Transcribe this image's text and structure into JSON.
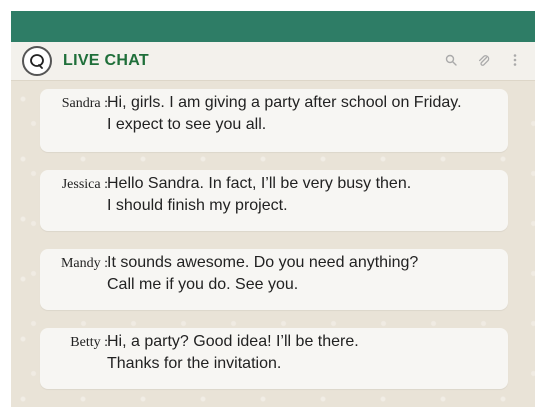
{
  "header": {
    "title": "LIVE CHAT"
  },
  "messages": [
    {
      "speaker": "Sandra :",
      "lines": [
        "Hi, girls. I am giving a party after school on Friday.",
        "I expect to see you all."
      ]
    },
    {
      "speaker": "Jessica :",
      "lines": [
        "Hello Sandra. In fact, I’ll be very busy then.",
        "I should finish my project."
      ]
    },
    {
      "speaker": "Mandy :",
      "lines": [
        "It sounds awesome. Do you need anything?",
        "Call me if you do. See you."
      ]
    },
    {
      "speaker": "Betty :",
      "lines": [
        "Hi, a party? Good idea! I’ll be there.",
        "Thanks for the invitation."
      ]
    }
  ],
  "icons": [
    "chat-logo-icon",
    "search-icon",
    "attach-icon",
    "more-vertical-icon"
  ],
  "colors": {
    "topbar": "#2e7d66",
    "title": "#1f6f3a",
    "chat_bg": "#e9e3d7",
    "bubble": "#f7f6f3"
  }
}
